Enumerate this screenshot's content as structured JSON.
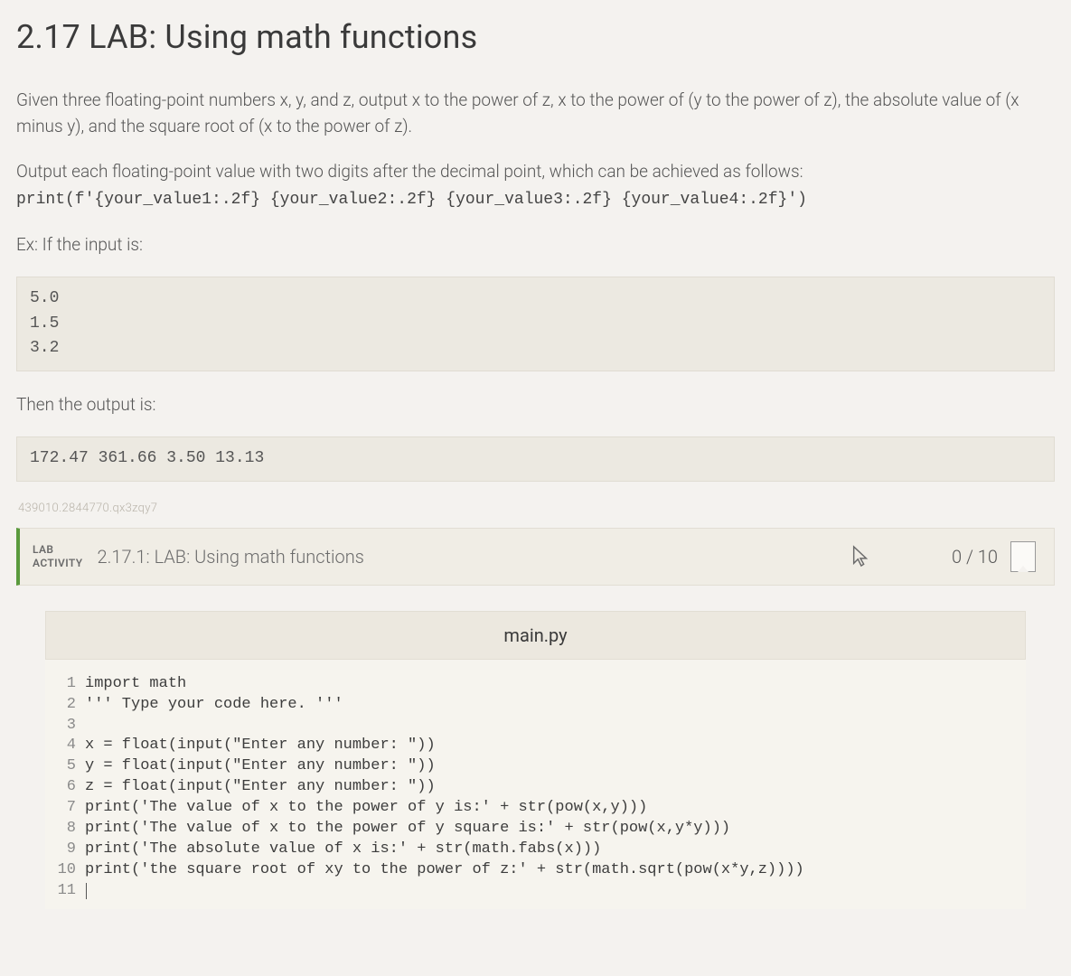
{
  "heading": "2.17 LAB: Using math functions",
  "p1": "Given three floating-point numbers x, y, and z, output x to the power of z, x to the power of (y to the power of z), the absolute value of (x minus y), and the square root of (x to the power of z).",
  "p2_lead": "Output each floating-point value with two digits after the decimal point, which can be achieved as follows:",
  "p2_code": "print(f'{your_value1:.2f} {your_value2:.2f} {your_value3:.2f} {your_value4:.2f}')",
  "ex_input_label": "Ex: If the input is:",
  "ex_input": "5.0\n1.5\n3.2",
  "ex_output_label": "Then the output is:",
  "ex_output": "172.47 361.66 3.50 13.13",
  "watermark": "439010.2844770.qx3zqy7",
  "lab_bar": {
    "badge_l1": "LAB",
    "badge_l2": "ACTIVITY",
    "title": "2.17.1: LAB: Using math functions",
    "score": "0 / 10"
  },
  "editor": {
    "filename": "main.py",
    "lines": [
      {
        "n": "1",
        "text": "import math"
      },
      {
        "n": "2",
        "text": "''' Type your code here. '''"
      },
      {
        "n": "3",
        "text": ""
      },
      {
        "n": "4",
        "text": "x = float(input(\"Enter any number: \"))"
      },
      {
        "n": "5",
        "text": "y = float(input(\"Enter any number: \"))"
      },
      {
        "n": "6",
        "text": "z = float(input(\"Enter any number: \"))"
      },
      {
        "n": "7",
        "text": "print('The value of x to the power of y is:' + str(pow(x,y)))"
      },
      {
        "n": "8",
        "text": "print('The value of x to the power of y square is:' + str(pow(x,y*y)))"
      },
      {
        "n": "9",
        "text": "print('The absolute value of x is:' + str(math.fabs(x)))"
      },
      {
        "n": "10",
        "text": "print('the square root of xy to the power of z:' + str(math.sqrt(pow(x*y,z))))"
      },
      {
        "n": "11",
        "text": ""
      }
    ]
  }
}
